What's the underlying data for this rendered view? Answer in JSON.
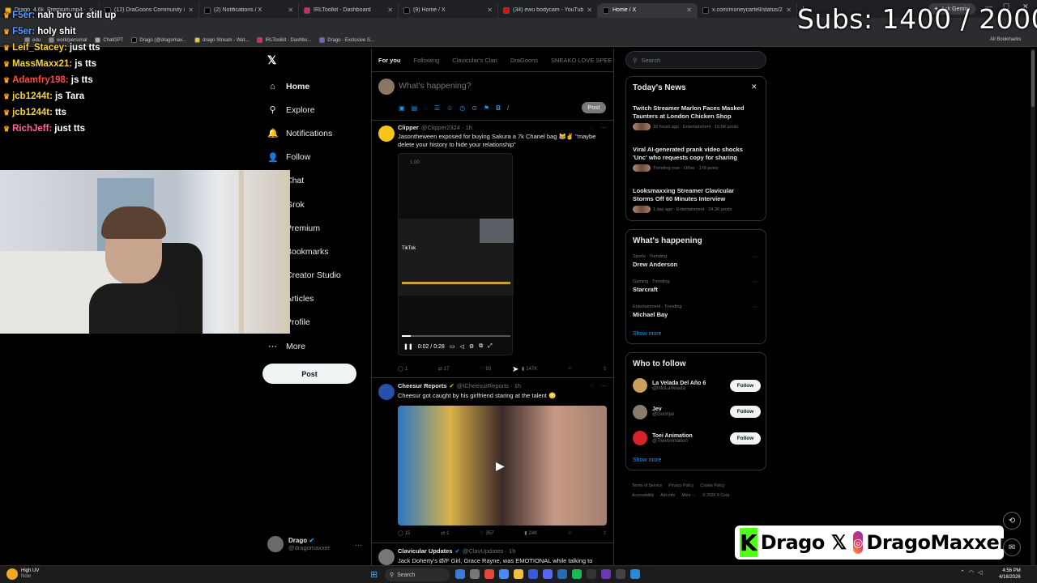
{
  "browser": {
    "tabs": [
      {
        "label": "Drago_4.6k_Premium.mp4 - G",
        "color": "#f5b400"
      },
      {
        "label": "(12) DraGoons Community / X",
        "color": "#000000"
      },
      {
        "label": "(2) Notifications / X",
        "color": "#000000"
      },
      {
        "label": "IRLToolkit - Dashboard",
        "color": "#e0245e"
      },
      {
        "label": "(9) Home / X",
        "color": "#000000"
      },
      {
        "label": "(34) ewu bodycam - YouTube",
        "color": "#ff0000"
      },
      {
        "label": "Home / X",
        "color": "#000000"
      },
      {
        "label": "x.com/moneycartell/status/20",
        "color": "#000000"
      }
    ],
    "gemini_label": "Ask Gemini",
    "bookmarks": [
      "edu",
      "work/personal",
      "ChatGPT",
      "Drago (@dragomax...",
      "drago Stream - Wat...",
      "IRLToolkit - Dashbo...",
      "Drago - Exclusive S..."
    ],
    "all_bookmarks": "All Bookmarks"
  },
  "overlay": {
    "subs": "Subs: 1400 / 2000",
    "chat": [
      {
        "user": "F5er:",
        "msg": "nah bro ur still up",
        "color": "#5a9cff"
      },
      {
        "user": "F5er:",
        "msg": "holy shit",
        "color": "#5a9cff"
      },
      {
        "user": "Leif_Stacey:",
        "msg": "just tts",
        "color": "#f5d33a"
      },
      {
        "user": "MassMaxx21:",
        "msg": "js tts",
        "color": "#f5d33a"
      },
      {
        "user": "Adamfry198:",
        "msg": "js tts",
        "color": "#ff4a4a"
      },
      {
        "user": "jcb1244t:",
        "msg": "js Tara",
        "color": "#f5d33a"
      },
      {
        "user": "jcb1244t:",
        "msg": "tts",
        "color": "#f5d33a"
      },
      {
        "user": "RichJeff:",
        "msg": "just tts",
        "color": "#ff6a9a"
      }
    ],
    "brand_kick": "Drago",
    "brand_ig": "DragoMaxxer"
  },
  "x_nav": {
    "items": [
      {
        "label": "Home",
        "icon": "⌂"
      },
      {
        "label": "Explore",
        "icon": "⚲"
      },
      {
        "label": "Notifications",
        "icon": "🔔"
      },
      {
        "label": "Follow",
        "icon": "👤"
      },
      {
        "label": "Chat",
        "icon": "✉"
      },
      {
        "label": "Grok",
        "icon": "◪"
      },
      {
        "label": "Premium",
        "icon": "✕"
      },
      {
        "label": "Bookmarks",
        "icon": "🔖"
      },
      {
        "label": "Creator Studio",
        "icon": "⚡"
      },
      {
        "label": "Articles",
        "icon": "▤"
      },
      {
        "label": "Profile",
        "icon": "👤"
      },
      {
        "label": "More",
        "icon": "⋯"
      }
    ],
    "post_button": "Post",
    "account_name": "Drago",
    "account_handle": "@dragomaxxer"
  },
  "feed": {
    "tabs": [
      "For you",
      "Following",
      "Clavicular's Clan",
      "DraGoons",
      "SNEAKO LOVE SPEE"
    ],
    "compose_placeholder": "What's happening?",
    "compose_post": "Post",
    "tweets": [
      {
        "name": "Clipper",
        "handle": "@Clipper2324 · 1h",
        "text": "Jasontheween exposed for buying Sakura a 7k Chanel bag 😹✌️ \"maybe delete your history to hide your relationship\"",
        "video_speed": "1.00",
        "video_time": "0:02 / 0:28",
        "tiktok_label": "TikTok",
        "replies": "1",
        "reposts": "17",
        "likes": "93",
        "views": "147K",
        "avatar_color": "#f5c518"
      },
      {
        "name": "Cheesur Reports",
        "handle": "@ICheesurReports · 1h",
        "text": "Cheesur got caught by his girlfriend staring at the talent 😳",
        "replies": "15",
        "reposts": "1",
        "likes": "357",
        "views": "24K",
        "avatar_color": "#2a4fa8"
      },
      {
        "name": "Clavicular Updates",
        "handle": "@ClavUpdates · 1h",
        "text": "Jack Doherty's Ø/F Girl, Grace Rayne, was EMOTIONAL while talking to",
        "avatar_color": "#777777"
      }
    ]
  },
  "sidebar": {
    "search_placeholder": "Search",
    "news_title": "Today's News",
    "news": [
      {
        "title": "Twitch Streamer Marlon Faces Masked Taunters at London Chicken Shop",
        "meta": "18 hours ago · Entertainment · 16.5K posts"
      },
      {
        "title": "Viral AI-generated prank video shocks 'Unc' who requests copy for sharing",
        "meta": "Trending now · Other · 178 posts"
      },
      {
        "title": "Looksmaxxing Streamer Clavicular Storms Off 60 Minutes Interview",
        "meta": "1 day ago · Entertainment · 24.3K posts"
      }
    ],
    "happening_title": "What's happening",
    "trends": [
      {
        "category": "Sports · Trending",
        "name": "Drew Anderson"
      },
      {
        "category": "Gaming · Trending",
        "name": "Starcraft"
      },
      {
        "category": "Entertainment · Trending",
        "name": "Michael Bay"
      }
    ],
    "show_more": "Show more",
    "wtf_title": "Who to follow",
    "who_to_follow": [
      {
        "name": "La Velada Del Año 6",
        "handle": "@infoLaVelada",
        "color": "#c9a15a"
      },
      {
        "name": "Jev",
        "handle": "@Goonjar",
        "color": "#8a7a6a"
      },
      {
        "name": "Toei Animation",
        "handle": "@ToeiAnimation",
        "color": "#d8232a"
      }
    ],
    "follow_label": "Follow",
    "footer": [
      "Terms of Service",
      "Privacy Policy",
      "Cookie Policy",
      "Accessibility",
      "Ads info",
      "More ···",
      "© 2026 X Corp."
    ]
  },
  "taskbar": {
    "weather_title": "High UV",
    "weather_sub": "Now",
    "search_label": "Search",
    "time": "4:56 PM",
    "date": "4/16/2026"
  }
}
